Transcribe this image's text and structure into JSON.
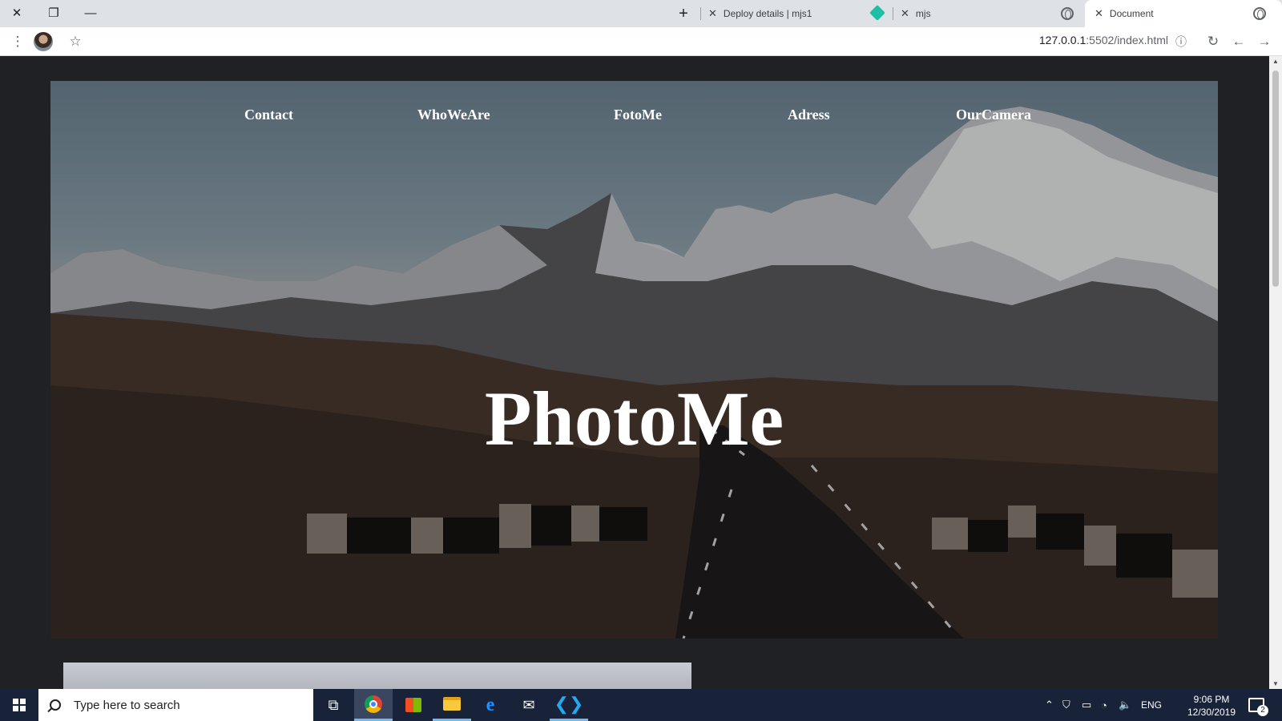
{
  "browser": {
    "tabs": [
      {
        "title": "Deploy details | mjs1",
        "active": false
      },
      {
        "title": "mjs",
        "active": false
      },
      {
        "title": "Document",
        "active": true
      }
    ],
    "new_tab_glyph": "+",
    "address": {
      "host": "127.0.0.1",
      "rest": ":5502/index.html"
    }
  },
  "page": {
    "nav": [
      "Contact",
      "WhoWeAre",
      "FotoMe",
      "Adress",
      "OurCamera"
    ],
    "hero_title": "PhotoMe"
  },
  "taskbar": {
    "search_placeholder": "Type here to search",
    "language": "ENG",
    "time": "9:06 PM",
    "date": "12/30/2019",
    "notification_count": "2"
  },
  "colors": {
    "taskbar": "#18233a",
    "page_bg": "#202124",
    "tab_strip": "#dee1e6"
  }
}
